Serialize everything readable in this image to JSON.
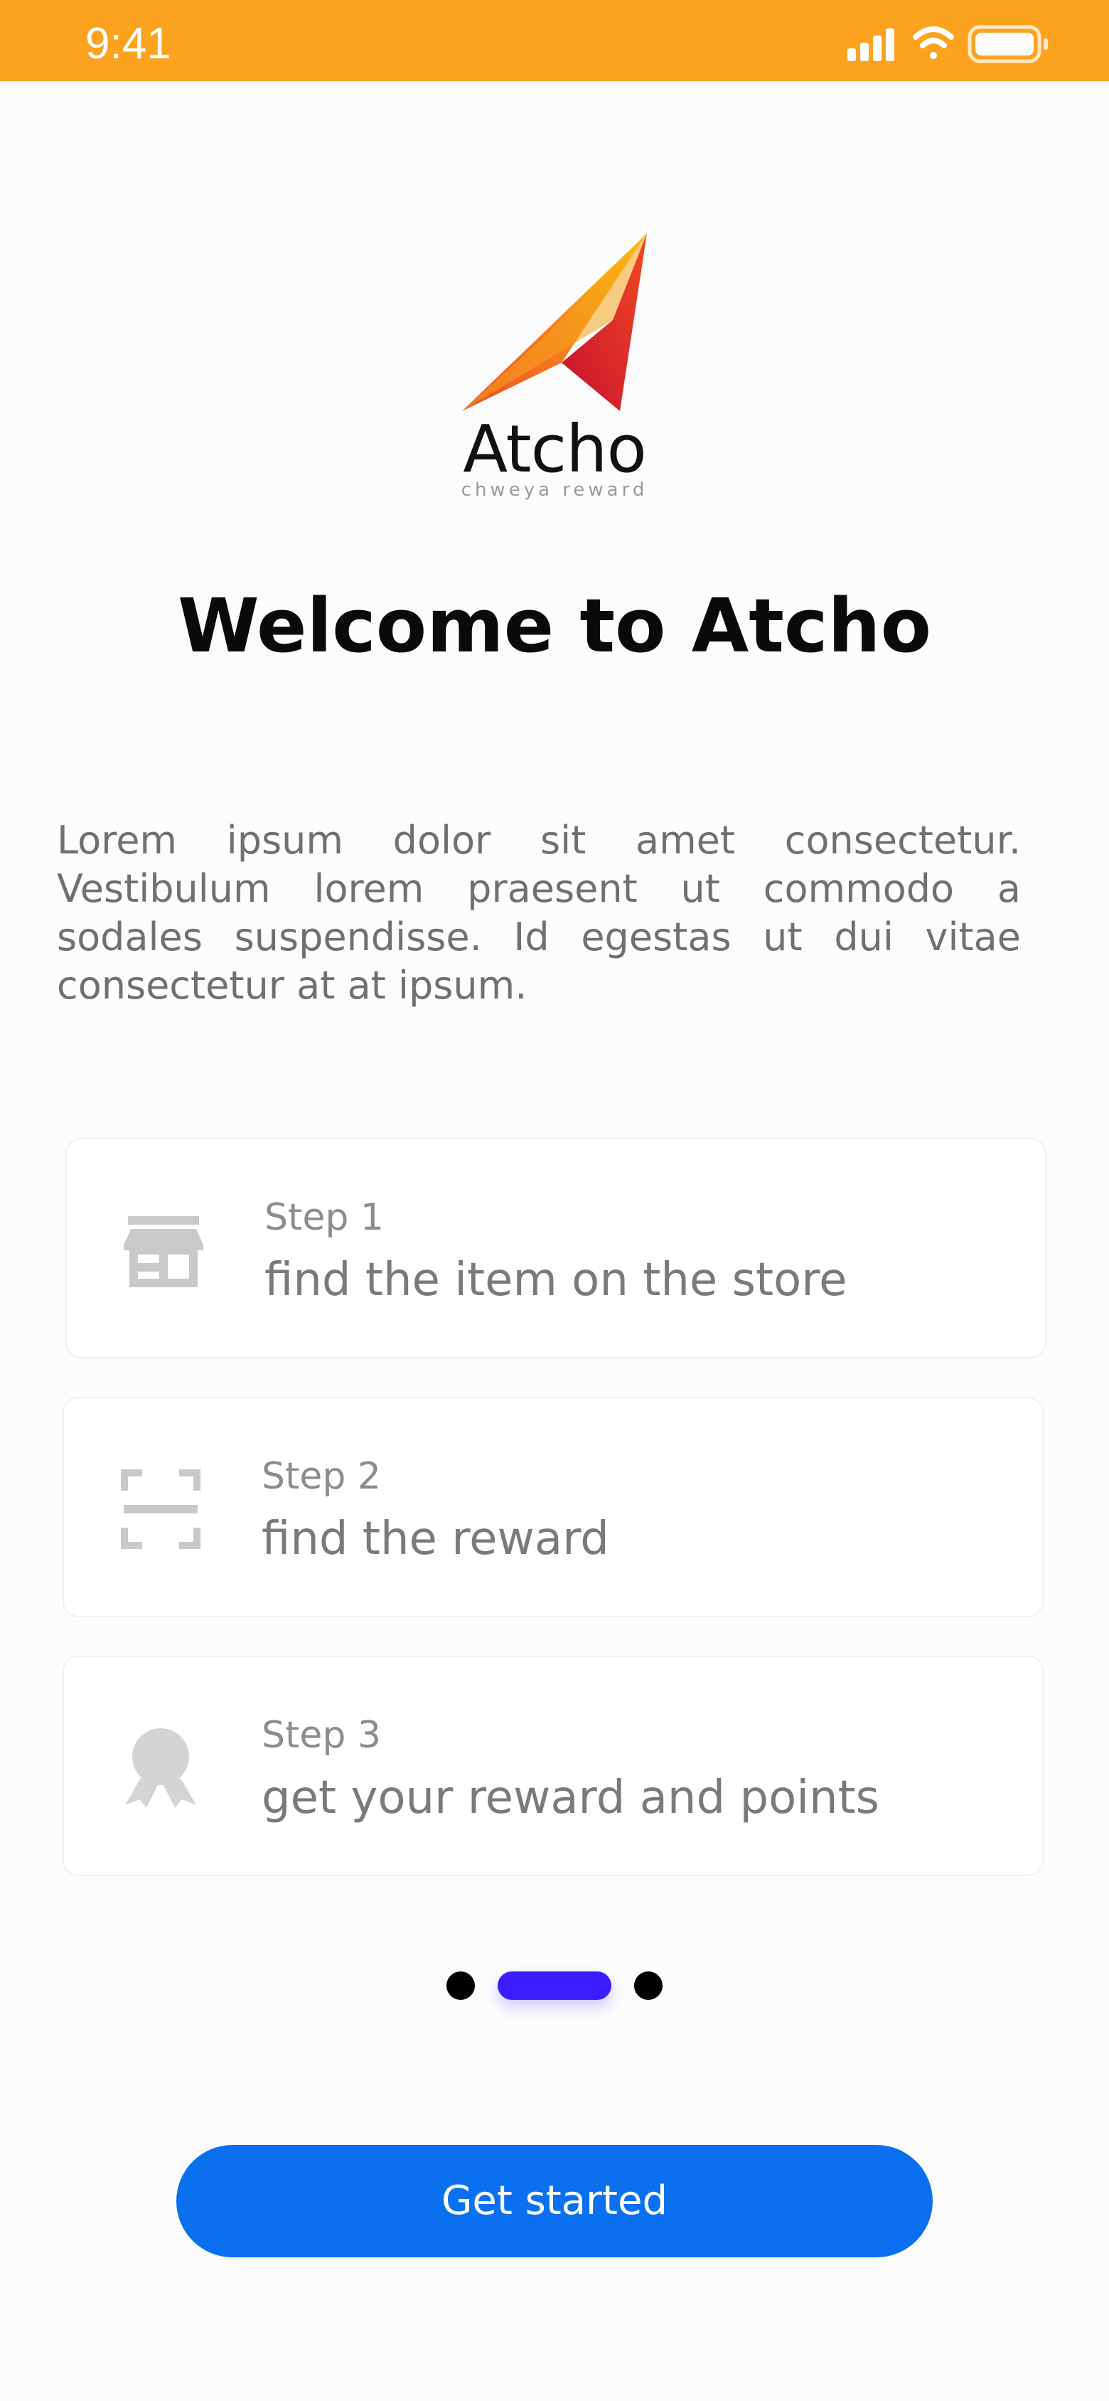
{
  "status_bar": {
    "time": "9:41",
    "background": "#fba31f",
    "icons": [
      "signal-icon",
      "wifi-icon",
      "battery-icon"
    ]
  },
  "brand": {
    "name": "Atcho",
    "tagline": "chweya reward"
  },
  "title": "Welcome to Atcho",
  "description": "Lorem ipsum dolor sit amet consectetur. Vestibulum lorem praesent ut commodo a sodales suspendisse. Id egestas ut dui vitae consectetur at at ipsum.",
  "steps": [
    {
      "label": "Step 1",
      "text": "find the item on the store",
      "icon": "store-icon"
    },
    {
      "label": "Step 2",
      "text": "find the reward",
      "icon": "scan-icon"
    },
    {
      "label": "Step 3",
      "text": "get your reward and points",
      "icon": "award-icon"
    }
  ],
  "pager": {
    "count": 3,
    "active_index": 1,
    "active_color": "#3d1cff"
  },
  "cta": {
    "label": "Get started",
    "color": "#0a70f0"
  }
}
